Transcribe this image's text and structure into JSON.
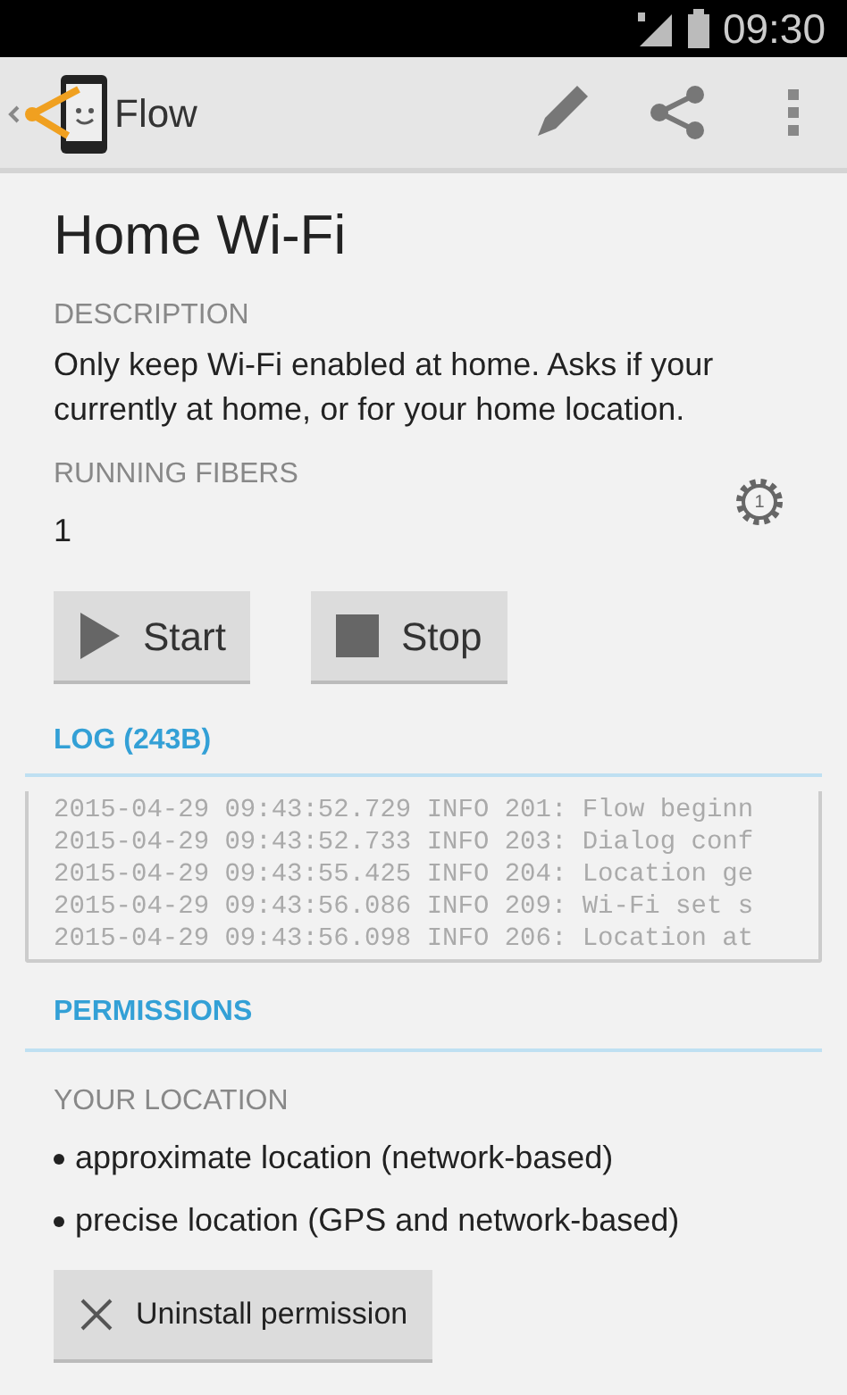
{
  "status_bar": {
    "time": "09:30"
  },
  "action_bar": {
    "title": "Flow"
  },
  "flow": {
    "title": "Home Wi-Fi",
    "description_label": "DESCRIPTION",
    "description": "Only keep Wi-Fi enabled at home. Asks if your currently at home, or for your home location.",
    "running_label": "RUNNING FIBERS",
    "running_count": "1",
    "fiber_badge": "1"
  },
  "buttons": [
    {
      "kind": "start",
      "label": "Start"
    },
    {
      "kind": "stop",
      "label": "Stop"
    }
  ],
  "log": {
    "heading": "LOG (243B)",
    "lines": [
      "2015-04-29 09:43:52.729 INFO 201: Flow beginn",
      "2015-04-29 09:43:52.733 INFO 203: Dialog conf",
      "2015-04-29 09:43:55.425 INFO 204: Location ge",
      "2015-04-29 09:43:56.086 INFO 209: Wi-Fi set s",
      "2015-04-29 09:43:56.098 INFO 206: Location at"
    ]
  },
  "permissions": {
    "heading": "PERMISSIONS",
    "group": "YOUR LOCATION",
    "items": [
      "approximate location (network-based)",
      "precise location (GPS and network-based)"
    ],
    "button": "Uninstall permission"
  }
}
